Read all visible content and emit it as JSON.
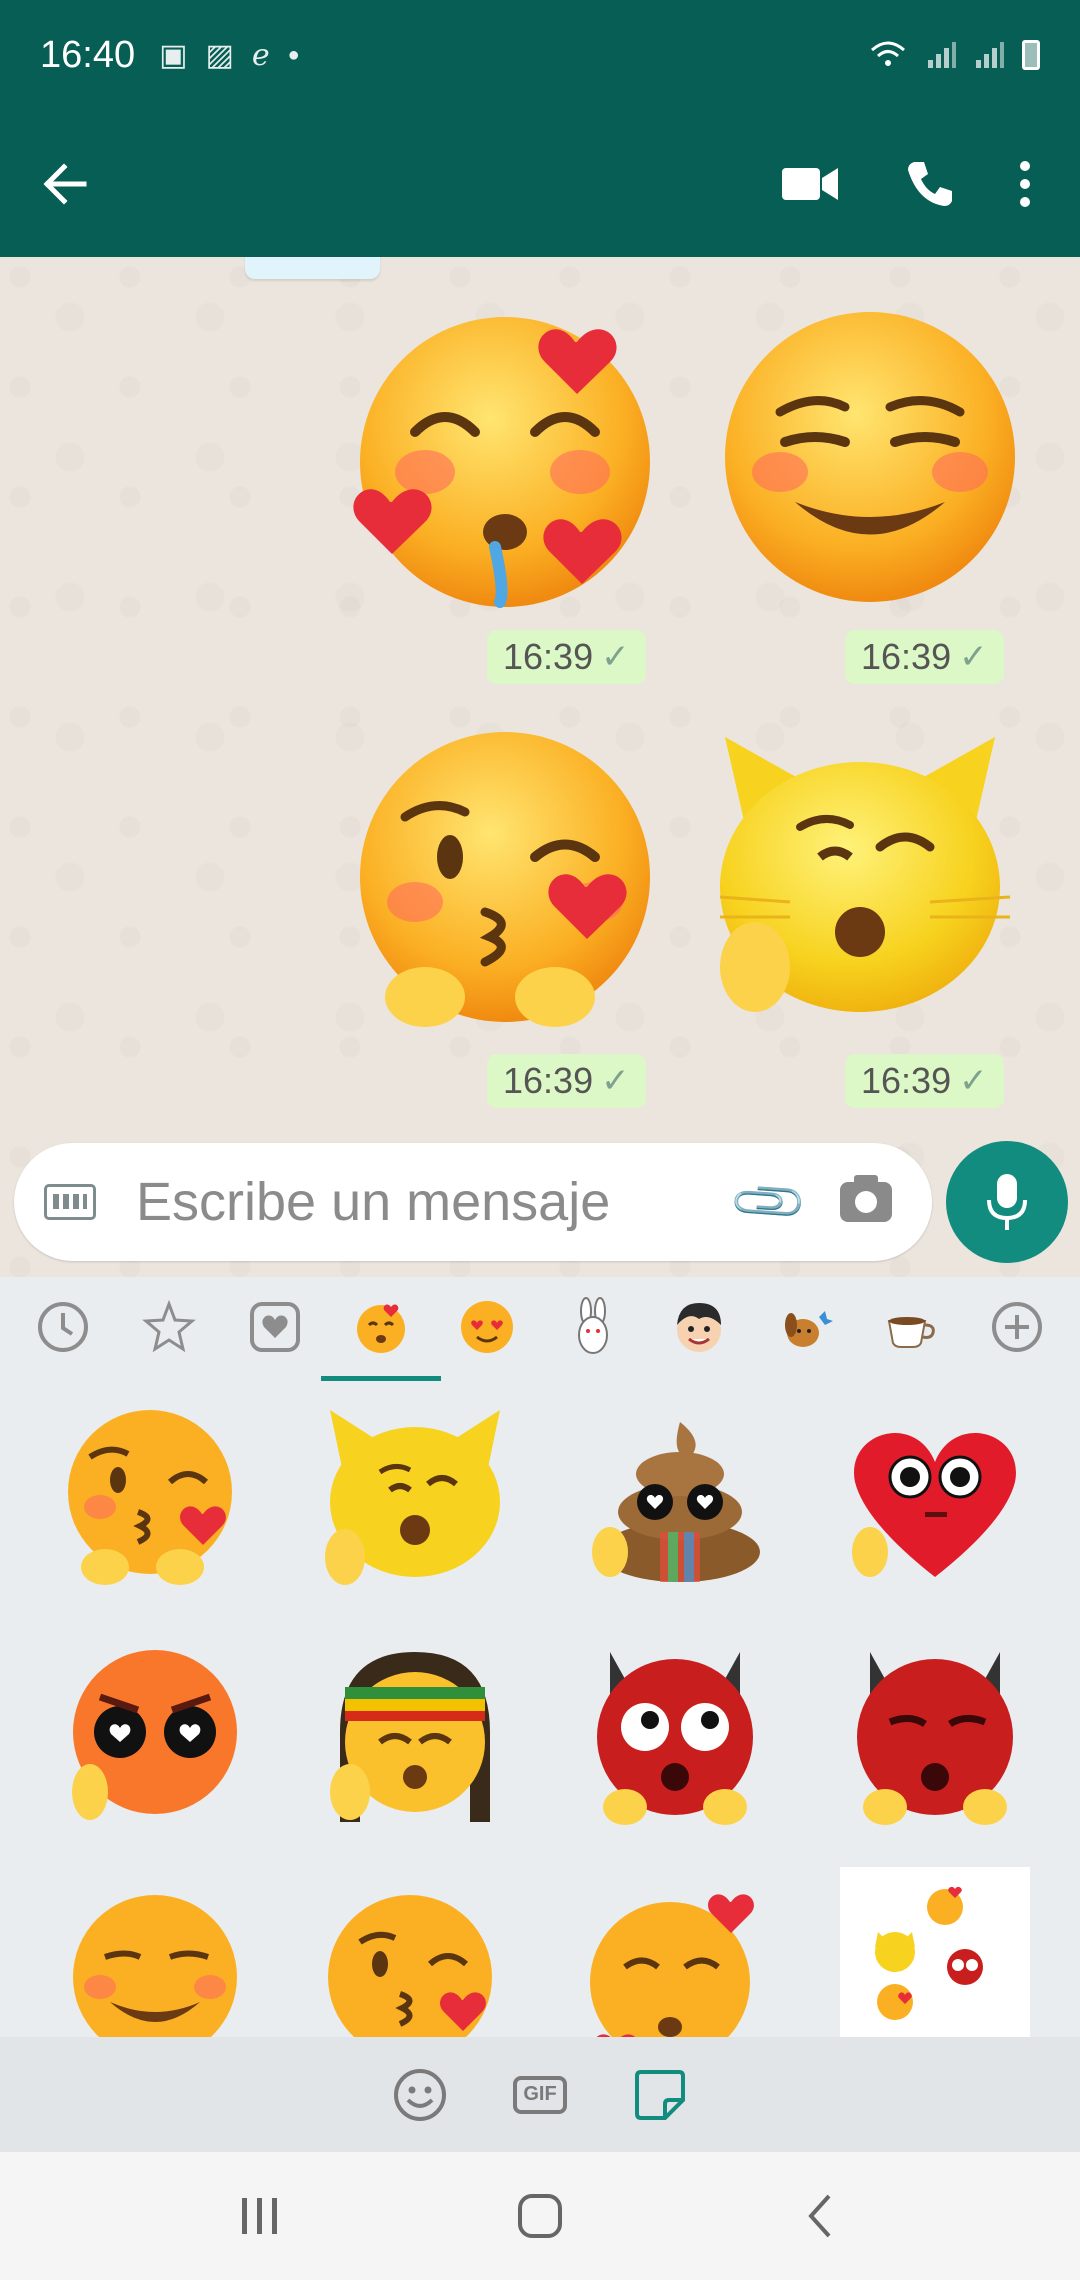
{
  "status_bar": {
    "time": "16:40",
    "icons": [
      "bank-icon",
      "image-icon",
      "eclipse-icon",
      "dot-icon"
    ],
    "right_icons": [
      "wifi-icon",
      "signal-icon",
      "signal-icon",
      "battery-icon"
    ]
  },
  "app_bar": {
    "back_icon": "arrow-left-icon",
    "actions": [
      "video-call-icon",
      "phone-icon",
      "more-vert-icon"
    ]
  },
  "chat": {
    "messages": [
      {
        "sticker": "smiling-face-with-hearts",
        "time": "16:39",
        "status": "sent"
      },
      {
        "sticker": "smirking-face",
        "time": "16:39",
        "status": "sent"
      },
      {
        "sticker": "kissing-face-with-heart",
        "time": "16:39",
        "status": "sent"
      },
      {
        "sticker": "cat-face-rock-hand",
        "time": "16:39",
        "status": "sent"
      }
    ]
  },
  "input": {
    "placeholder": "Escribe un mensaje"
  },
  "sticker_panel": {
    "tabs": [
      {
        "name": "recent",
        "icon": "clock-icon"
      },
      {
        "name": "favorites",
        "icon": "star-icon"
      },
      {
        "name": "heart-pack",
        "icon": "heart-icon"
      },
      {
        "name": "pack-emoji-1",
        "icon": "emoji-pack-icon",
        "active": true
      },
      {
        "name": "pack-emoji-2",
        "icon": "heart-eyes-icon"
      },
      {
        "name": "pack-bunny",
        "icon": "bunny-icon"
      },
      {
        "name": "pack-boy",
        "icon": "boy-face-icon"
      },
      {
        "name": "pack-dog",
        "icon": "dog-icon"
      },
      {
        "name": "pack-cup",
        "icon": "coffee-cup-icon"
      },
      {
        "name": "add-pack",
        "icon": "plus-circle-icon"
      }
    ],
    "stickers": [
      "kissing-heart",
      "cat-rock",
      "poop-hearts",
      "heart-face",
      "angry-heart-eyes",
      "rasta-face",
      "red-devil-eyes",
      "red-devil",
      "smirk",
      "kiss-heart",
      "hearts-face",
      "sticker-pack-preview"
    ]
  },
  "toolbar": {
    "items": [
      "emoji-icon",
      "gif-icon",
      "sticker-icon"
    ],
    "gif_label": "GIF"
  },
  "colors": {
    "primary": "#075e54",
    "accent": "#128c7e",
    "outgoing_bubble": "#dcf8c6"
  }
}
